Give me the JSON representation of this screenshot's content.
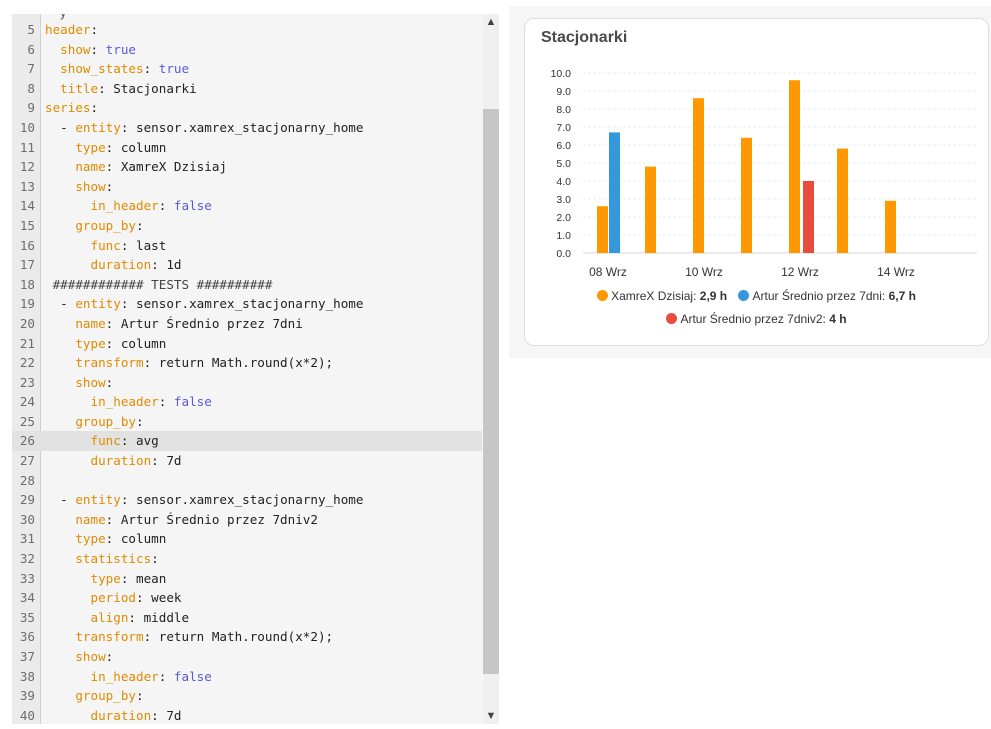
{
  "editor": {
    "partial_top": "· y",
    "lines": [
      {
        "n": "5",
        "parts": [
          {
            "t": "header",
            "c": "k"
          },
          {
            "t": ":",
            "c": "s"
          }
        ]
      },
      {
        "n": "6",
        "parts": [
          {
            "t": "  show",
            "c": "k"
          },
          {
            "t": ": ",
            "c": "s"
          },
          {
            "t": "true",
            "c": "v"
          }
        ]
      },
      {
        "n": "7",
        "parts": [
          {
            "t": "  show_states",
            "c": "k"
          },
          {
            "t": ": ",
            "c": "s"
          },
          {
            "t": "true",
            "c": "v"
          }
        ]
      },
      {
        "n": "8",
        "parts": [
          {
            "t": "  title",
            "c": "k"
          },
          {
            "t": ": Stacjonarki",
            "c": "s"
          }
        ]
      },
      {
        "n": "9",
        "parts": [
          {
            "t": "series",
            "c": "k"
          },
          {
            "t": ":",
            "c": "s"
          }
        ]
      },
      {
        "n": "10",
        "parts": [
          {
            "t": "  - ",
            "c": "s"
          },
          {
            "t": "entity",
            "c": "k"
          },
          {
            "t": ": sensor.xamrex_stacjonarny_home",
            "c": "s"
          }
        ]
      },
      {
        "n": "11",
        "parts": [
          {
            "t": "    type",
            "c": "k"
          },
          {
            "t": ": column",
            "c": "s"
          }
        ]
      },
      {
        "n": "12",
        "parts": [
          {
            "t": "    name",
            "c": "k"
          },
          {
            "t": ": XamreX Dzisiaj",
            "c": "s"
          }
        ]
      },
      {
        "n": "13",
        "parts": [
          {
            "t": "    show",
            "c": "k"
          },
          {
            "t": ":",
            "c": "s"
          }
        ]
      },
      {
        "n": "14",
        "parts": [
          {
            "t": "      in_header",
            "c": "k"
          },
          {
            "t": ": ",
            "c": "s"
          },
          {
            "t": "false",
            "c": "v"
          }
        ]
      },
      {
        "n": "15",
        "parts": [
          {
            "t": "    group_by",
            "c": "k"
          },
          {
            "t": ":",
            "c": "s"
          }
        ]
      },
      {
        "n": "16",
        "parts": [
          {
            "t": "      func",
            "c": "k"
          },
          {
            "t": ": last",
            "c": "s"
          }
        ]
      },
      {
        "n": "17",
        "parts": [
          {
            "t": "      duration",
            "c": "k"
          },
          {
            "t": ": 1d",
            "c": "s"
          }
        ]
      },
      {
        "n": "18",
        "parts": [
          {
            "t": " ############ TESTS ##########",
            "c": "cm"
          }
        ]
      },
      {
        "n": "19",
        "parts": [
          {
            "t": "  - ",
            "c": "s"
          },
          {
            "t": "entity",
            "c": "k"
          },
          {
            "t": ": sensor.xamrex_stacjonarny_home",
            "c": "s"
          }
        ]
      },
      {
        "n": "20",
        "parts": [
          {
            "t": "    name",
            "c": "k"
          },
          {
            "t": ": Artur Średnio przez 7dni",
            "c": "s"
          }
        ]
      },
      {
        "n": "21",
        "parts": [
          {
            "t": "    type",
            "c": "k"
          },
          {
            "t": ": column",
            "c": "s"
          }
        ]
      },
      {
        "n": "22",
        "parts": [
          {
            "t": "    transform",
            "c": "k"
          },
          {
            "t": ": return Math.round(x*2);",
            "c": "s"
          }
        ]
      },
      {
        "n": "23",
        "parts": [
          {
            "t": "    show",
            "c": "k"
          },
          {
            "t": ":",
            "c": "s"
          }
        ]
      },
      {
        "n": "24",
        "parts": [
          {
            "t": "      in_header",
            "c": "k"
          },
          {
            "t": ": ",
            "c": "s"
          },
          {
            "t": "false",
            "c": "v"
          }
        ]
      },
      {
        "n": "25",
        "parts": [
          {
            "t": "    group_by",
            "c": "k"
          },
          {
            "t": ":",
            "c": "s"
          }
        ]
      },
      {
        "n": "26",
        "active": true,
        "parts": [
          {
            "t": "      func",
            "c": "k"
          },
          {
            "t": ": avg",
            "c": "s"
          }
        ]
      },
      {
        "n": "27",
        "parts": [
          {
            "t": "      duration",
            "c": "k"
          },
          {
            "t": ": 7d",
            "c": "s"
          }
        ]
      },
      {
        "n": "28",
        "parts": []
      },
      {
        "n": "29",
        "parts": [
          {
            "t": "  - ",
            "c": "s"
          },
          {
            "t": "entity",
            "c": "k"
          },
          {
            "t": ": sensor.xamrex_stacjonarny_home",
            "c": "s"
          }
        ]
      },
      {
        "n": "30",
        "parts": [
          {
            "t": "    name",
            "c": "k"
          },
          {
            "t": ": Artur Średnio przez 7dniv2",
            "c": "s"
          }
        ]
      },
      {
        "n": "31",
        "parts": [
          {
            "t": "    type",
            "c": "k"
          },
          {
            "t": ": column",
            "c": "s"
          }
        ]
      },
      {
        "n": "32",
        "parts": [
          {
            "t": "    statistics",
            "c": "k"
          },
          {
            "t": ":",
            "c": "s"
          }
        ]
      },
      {
        "n": "33",
        "parts": [
          {
            "t": "      type",
            "c": "k"
          },
          {
            "t": ": mean",
            "c": "s"
          }
        ]
      },
      {
        "n": "34",
        "parts": [
          {
            "t": "      period",
            "c": "k"
          },
          {
            "t": ": week",
            "c": "s"
          }
        ]
      },
      {
        "n": "35",
        "parts": [
          {
            "t": "      align",
            "c": "k"
          },
          {
            "t": ": middle",
            "c": "s"
          }
        ]
      },
      {
        "n": "36",
        "parts": [
          {
            "t": "    transform",
            "c": "k"
          },
          {
            "t": ": return Math.round(x*2);",
            "c": "s"
          }
        ]
      },
      {
        "n": "37",
        "parts": [
          {
            "t": "    show",
            "c": "k"
          },
          {
            "t": ":",
            "c": "s"
          }
        ]
      },
      {
        "n": "38",
        "parts": [
          {
            "t": "      in_header",
            "c": "k"
          },
          {
            "t": ": ",
            "c": "s"
          },
          {
            "t": "false",
            "c": "v"
          }
        ]
      },
      {
        "n": "39",
        "parts": [
          {
            "t": "    group_by",
            "c": "k"
          },
          {
            "t": ":",
            "c": "s"
          }
        ]
      },
      {
        "n": "40",
        "parts": [
          {
            "t": "      duration",
            "c": "k"
          },
          {
            "t": ": 7d",
            "c": "s"
          }
        ]
      }
    ],
    "scroll_up_icon": "▲",
    "scroll_down_icon": "▼"
  },
  "card": {
    "title": "Stacjonarki",
    "legend": [
      {
        "name": "XamreX Dzisiaj",
        "value": "2,9 h",
        "color": "#ff9800"
      },
      {
        "name": "Artur Średnio przez 7dni",
        "value": "6,7 h",
        "color": "#3498db"
      },
      {
        "name": "Artur Średnio przez 7dniv2",
        "value": "4 h",
        "color": "#e74c3c"
      }
    ]
  },
  "chart_data": {
    "type": "bar",
    "title": "Stacjonarki",
    "ylim": [
      0,
      10
    ],
    "y_ticks": [
      "0.0",
      "1.0",
      "2.0",
      "3.0",
      "4.0",
      "5.0",
      "6.0",
      "7.0",
      "8.0",
      "9.0",
      "10.0"
    ],
    "x_ticks": [
      "08 Wrz",
      "10 Wrz",
      "12 Wrz",
      "14 Wrz"
    ],
    "x_ticks_day": [
      8,
      10,
      12,
      14
    ],
    "grid": true,
    "legend_position": "bottom",
    "series": [
      {
        "name": "XamreX Dzisiaj",
        "color": "#ff9800",
        "points": [
          {
            "day": 8,
            "value": 2.6
          },
          {
            "day": 9,
            "value": 4.8
          },
          {
            "day": 10,
            "value": 8.6
          },
          {
            "day": 11,
            "value": 6.4
          },
          {
            "day": 12,
            "value": 9.6
          },
          {
            "day": 13,
            "value": 5.8
          },
          {
            "day": 14,
            "value": 2.9
          }
        ]
      },
      {
        "name": "Artur Średnio przez 7dni",
        "color": "#3498db",
        "points": [
          {
            "day": 8,
            "value": 6.7
          }
        ]
      },
      {
        "name": "Artur Średnio przez 7dniv2",
        "color": "#e74c3c",
        "points": [
          {
            "day": 12,
            "value": 4.0
          }
        ]
      }
    ]
  }
}
